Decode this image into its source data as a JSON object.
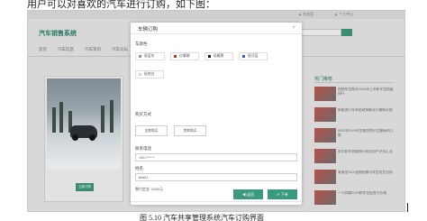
{
  "document": {
    "caption_top": "用户可以对喜欢的汽车进行订购，如下图：",
    "caption_bottom": "图 5.10 汽车共享管理系统汽车订购界面"
  },
  "site": {
    "top_links": [
      "▲ 欢迎您",
      "▲ 个人中心"
    ],
    "logo": "汽车销售系统",
    "nav": [
      "首页",
      "汽车信息",
      "汽车资讯",
      "汽车论坛",
      "留言反馈"
    ],
    "car_card_button": "立即订购",
    "sidebar": {
      "title": "热门推荐",
      "items": [
        "热销车型推荐2019年上市新车型销量排行",
        "新能源汽车补贴政策解读与最新价格",
        "2020年SUV车型推荐性价比最高的几款",
        "豪华轿车销量排行榜及用户评价汇总",
        "紧凑型SUV选购指南与车型对比分析",
        "一汽奔腾2019款车型配置与价格",
        "新能源车型续航里程测试结果公布",
        "最新款MPV车型发布会现场图片"
      ]
    }
  },
  "modal": {
    "title": "车辆订购",
    "close": "×",
    "color_label": "车颜色",
    "colors": [
      {
        "label": "星蓝灰",
        "swatch": "#8a94a6"
      },
      {
        "label": "红珊瑚",
        "swatch": "#c0302b"
      },
      {
        "label": "极曜黑",
        "swatch": "#1a1a1a"
      },
      {
        "label": "银河蓝",
        "swatch": "#3a5fa8"
      },
      {
        "label": "极地白",
        "swatch": "#f2f2f2"
      }
    ],
    "pay_label": "购买方式",
    "pay_options": [
      "全款购买",
      "贷款购买"
    ],
    "phone_label": "联系电话",
    "phone_placeholder": "1851******",
    "name_label": "姓名",
    "name_value": "test01",
    "deposit_label": "需付定金:",
    "deposit_value": "2000元",
    "btn_back": "◀ 返回",
    "btn_submit": "✔ 下单"
  }
}
